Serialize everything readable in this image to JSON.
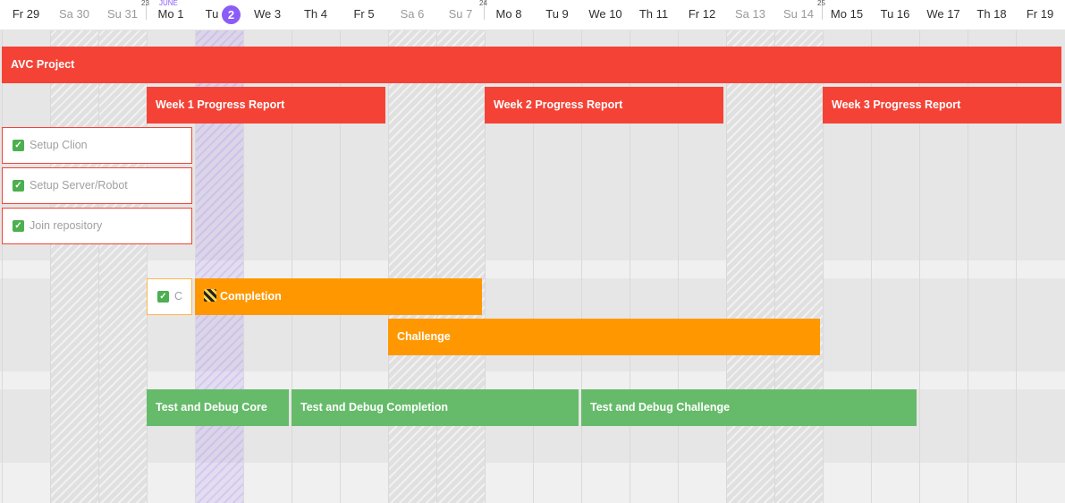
{
  "days": [
    {
      "label": "Fr 29",
      "weekend": false
    },
    {
      "label": "Sa 30",
      "weekend": true
    },
    {
      "label": "Su 31",
      "weekend": true
    },
    {
      "label": "Mo 1",
      "weekend": false
    },
    {
      "label": "Tu",
      "weekend": false,
      "today": true,
      "badge": "2"
    },
    {
      "label": "We 3",
      "weekend": false
    },
    {
      "label": "Th 4",
      "weekend": false
    },
    {
      "label": "Fr 5",
      "weekend": false
    },
    {
      "label": "Sa 6",
      "weekend": true
    },
    {
      "label": "Su 7",
      "weekend": true
    },
    {
      "label": "Mo 8",
      "weekend": false
    },
    {
      "label": "Tu 9",
      "weekend": false
    },
    {
      "label": "We 10",
      "weekend": false
    },
    {
      "label": "Th 11",
      "weekend": false
    },
    {
      "label": "Fr 12",
      "weekend": false
    },
    {
      "label": "Sa 13",
      "weekend": true
    },
    {
      "label": "Su 14",
      "weekend": true
    },
    {
      "label": "Mo 15",
      "weekend": false
    },
    {
      "label": "Tu 16",
      "weekend": false
    },
    {
      "label": "We 17",
      "weekend": false
    },
    {
      "label": "Th 18",
      "weekend": false
    },
    {
      "label": "Fr 19",
      "weekend": false
    }
  ],
  "week_numbers": [
    "23",
    "24",
    "25"
  ],
  "month_label": "JUNE",
  "bars": {
    "avc_project": "AVC Project",
    "week1": "Week 1 Progress Report",
    "week2": "Week 2 Progress Report",
    "week3": "Week 3 Progress Report",
    "completion": "Completion",
    "challenge": "Challenge",
    "test_core": "Test and Debug Core",
    "test_completion": "Test and Debug Completion",
    "test_challenge": "Test and Debug Challenge"
  },
  "tasks": {
    "setup_clion": "Setup Clion",
    "setup_server": "Setup Server/Robot",
    "join_repo": "Join repository",
    "core_truncated": "C"
  },
  "colors": {
    "red": "#f44336",
    "orange": "#ff9800",
    "green": "#66bb6a",
    "today": "#8b5cf6"
  }
}
